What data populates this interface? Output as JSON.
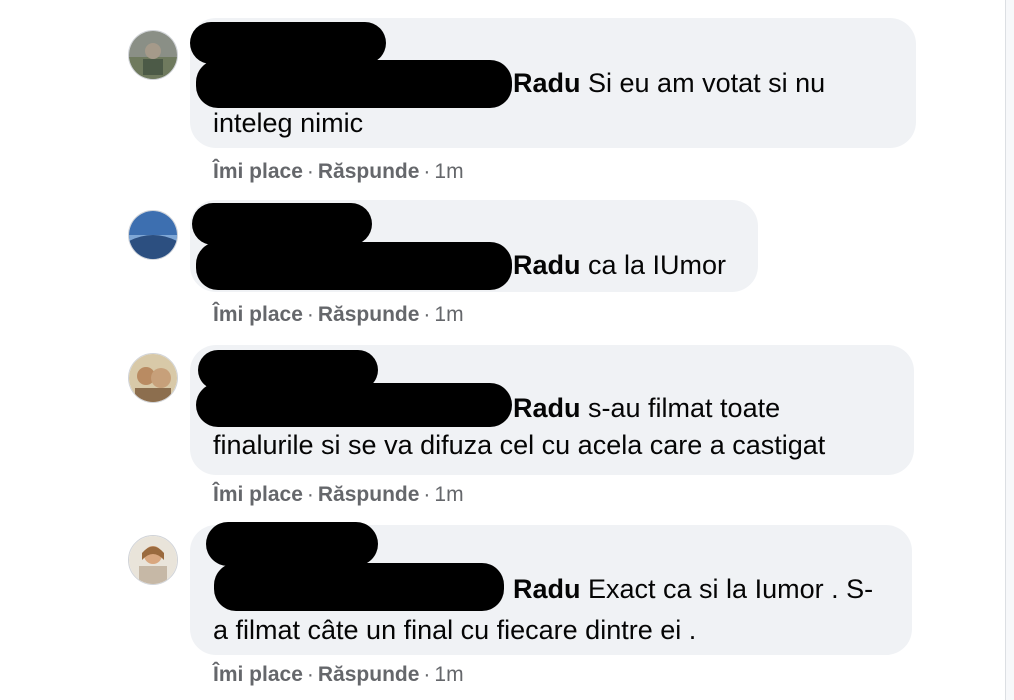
{
  "comments": [
    {
      "name": "Radu",
      "line1": "Si eu am votat si nu",
      "line2": "inteleg nimic",
      "like": "Îmi place",
      "reply": "Răspunde",
      "sep": "·",
      "time": "1m"
    },
    {
      "name": "Radu",
      "line1": "ca la IUmor",
      "line2": "",
      "like": "Îmi place",
      "reply": "Răspunde",
      "sep": "·",
      "time": "1m"
    },
    {
      "name": "Radu",
      "line1": "s-au filmat toate",
      "line2": "finalurile si se va difuza cel cu acela care a castigat",
      "like": "Îmi place",
      "reply": "Răspunde",
      "sep": "·",
      "time": "1m"
    },
    {
      "name": "Radu",
      "line1": "Exact ca si la Iumor . S-",
      "line2": "a filmat câte un final cu fiecare dintre ei .",
      "like": "Îmi place",
      "reply": "Răspunde",
      "sep": "·",
      "time": "1m"
    }
  ],
  "colors": {
    "bubble": "#f0f2f5",
    "text": "#050505",
    "meta": "#65676b",
    "redaction": "#000000"
  }
}
